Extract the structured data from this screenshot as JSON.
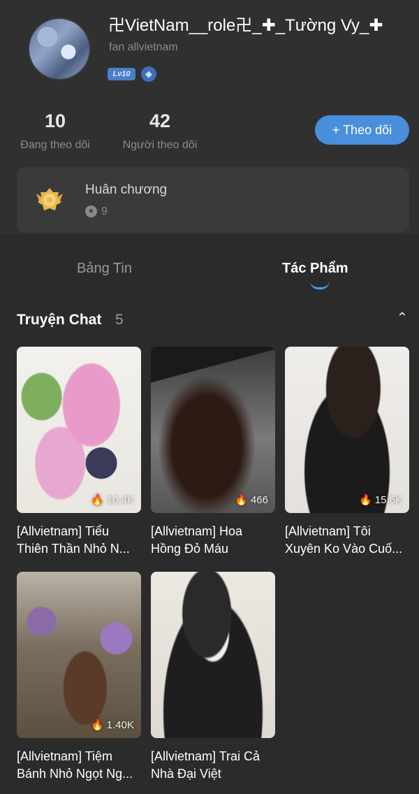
{
  "profile": {
    "username": "卍VietNam__role卍_✚_Tường Vy_✚",
    "subtitle": "fan allvietnam",
    "level_badge": "Lv10",
    "level_icon": "diamond-icon",
    "stats": {
      "following_count": "10",
      "following_label": "Đang theo dõi",
      "followers_count": "42",
      "followers_label": "Người theo dõi"
    },
    "follow_button": "+ Theo dõi",
    "accent_color": "#4a8fdb"
  },
  "medals": {
    "title": "Huân chương",
    "count": "9"
  },
  "tabs": [
    {
      "label": "Bảng Tin",
      "active": false
    },
    {
      "label": "Tác Phẩm",
      "active": true
    }
  ],
  "section": {
    "title": "Truyện Chat",
    "count": "5"
  },
  "stories": [
    {
      "title": "[Allvietnam] Tiểu Thiên Thần Nhỏ N...",
      "views": "10.4K"
    },
    {
      "title": "[Allvietnam] Hoa Hồng Đỏ Máu",
      "views": "466"
    },
    {
      "title": "[Allvietnam] Tôi Xuyên Ko Vào Cuố...",
      "views": "15.6K"
    },
    {
      "title": "[Allvietnam] Tiệm Bánh Nhỏ Ngọt Ng...",
      "views": "1.40K"
    },
    {
      "title": "[Allvietnam] Trai Cả Nhà Đại Việt",
      "views": ""
    }
  ]
}
